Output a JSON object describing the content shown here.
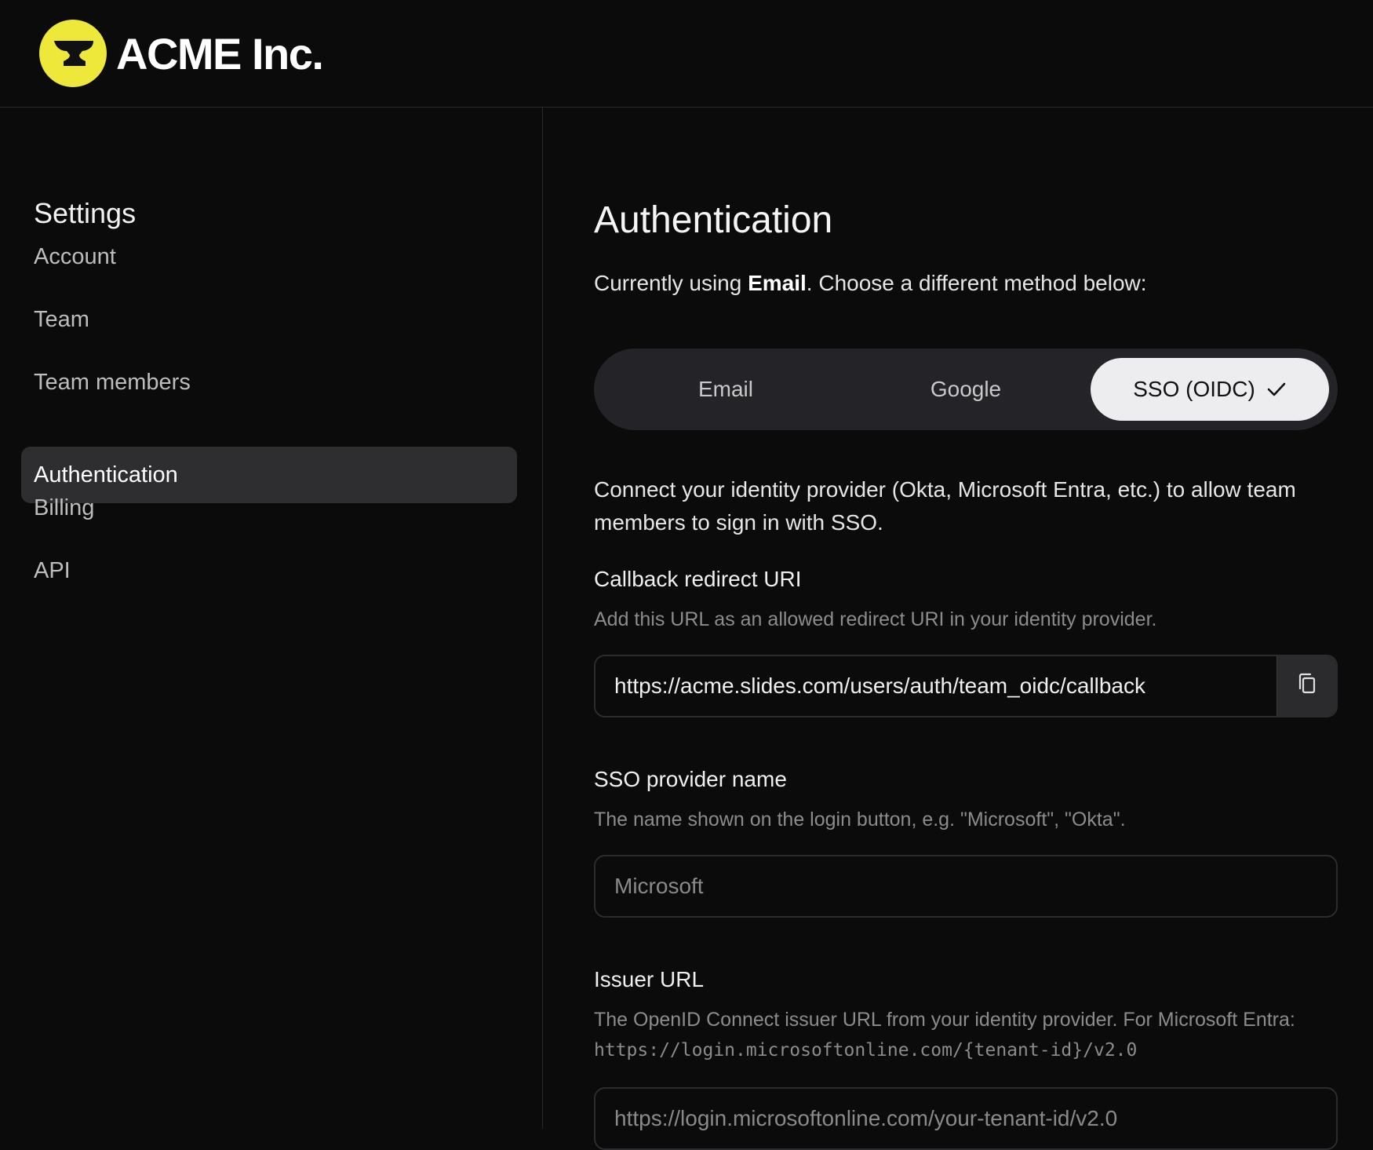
{
  "header": {
    "brand": "ACME Inc.",
    "logo_icon": "anvil-icon",
    "logo_color": "#ede83a"
  },
  "sidebar": {
    "title": "Settings",
    "items": [
      {
        "label": "Account"
      },
      {
        "label": "Team"
      },
      {
        "label": "Team members"
      },
      {
        "label": "Authentication",
        "active": true
      },
      {
        "label": "Billing"
      },
      {
        "label": "API"
      }
    ]
  },
  "main": {
    "title": "Authentication",
    "current_prefix": "Currently using ",
    "current_method": "Email",
    "current_suffix": ". Choose a different method below:",
    "methods": [
      {
        "label": "Email"
      },
      {
        "label": "Google"
      },
      {
        "label": "SSO (OIDC)",
        "selected": true
      }
    ],
    "intro": "Connect your identity provider (Okta, Microsoft Entra, etc.) to allow team members to sign in with SSO.",
    "callback": {
      "label": "Callback redirect URI",
      "help": "Add this URL as an allowed redirect URI in your identity provider.",
      "value": "https://acme.slides.com/users/auth/team_oidc/callback",
      "copy_icon": "copy-icon"
    },
    "provider_name": {
      "label": "SSO provider name",
      "help": "The name shown on the login button, e.g. \"Microsoft\", \"Okta\".",
      "placeholder": "Microsoft"
    },
    "issuer": {
      "label": "Issuer URL",
      "help_prefix": "The OpenID Connect issuer URL from your identity provider. For Microsoft Entra: ",
      "help_code": "https://login.microsoftonline.com/{tenant-id}/v2.0",
      "placeholder": "https://login.microsoftonline.com/your-tenant-id/v2.0"
    }
  }
}
